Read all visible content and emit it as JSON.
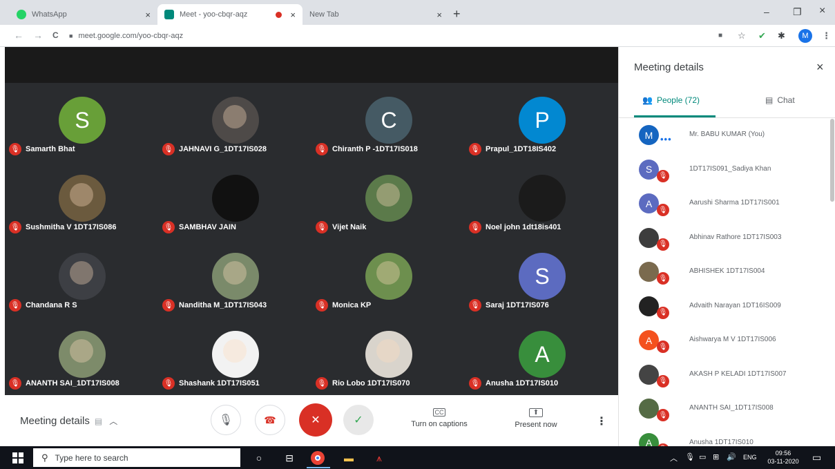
{
  "browser": {
    "tabs": [
      {
        "title": "WhatsApp",
        "favicon_color": "#25d366",
        "active": false
      },
      {
        "title": "Meet - yoo-cbqr-aqz",
        "favicon_color": "#00897b",
        "active": true,
        "recording": true
      },
      {
        "title": "New Tab",
        "favicon_color": "",
        "active": false
      }
    ],
    "tab_close": "×",
    "new_tab": "+",
    "window_controls": {
      "minimize": "–",
      "maximize": "❐",
      "close": "×"
    },
    "nav": {
      "back": "←",
      "forward": "→",
      "reload": "C"
    },
    "url": "meet.google.com/yoo-cbqr-aqz",
    "profile_initial": "M"
  },
  "meet": {
    "tiles": [
      {
        "name": "Samarth Bhat",
        "initial": "S",
        "color": "#689f38"
      },
      {
        "name": "JAHNAVI G_1DT17IS028",
        "initial": "",
        "color": "#4e4a48"
      },
      {
        "name": "Chiranth P -1DT17IS018",
        "initial": "C",
        "color": "#455a64"
      },
      {
        "name": "Prapul_1DT18IS402",
        "initial": "P",
        "color": "#0288d1"
      },
      {
        "name": "Sushmitha V 1DT17IS086",
        "initial": "",
        "color": "#6b5a3e"
      },
      {
        "name": "SAMBHAV JAIN",
        "initial": "",
        "color": "#111111"
      },
      {
        "name": "Vijet Naik",
        "initial": "",
        "color": "#5b7a4a"
      },
      {
        "name": "Noel john 1dt18is401",
        "initial": "",
        "color": "#1b1b1b"
      },
      {
        "name": "Chandana R S",
        "initial": "",
        "color": "#3d3f44"
      },
      {
        "name": "Nanditha M_1DT17IS043",
        "initial": "",
        "color": "#7a8a6a"
      },
      {
        "name": "Monica KP",
        "initial": "",
        "color": "#6d8f4e"
      },
      {
        "name": "Saraj 1DT17IS076",
        "initial": "S",
        "color": "#5c6bc0"
      },
      {
        "name": "ANANTH SAI_1DT17IS008",
        "initial": "",
        "color": "#7d8b6a"
      },
      {
        "name": "Shashank 1DT17IS051",
        "initial": "",
        "color": "#f2f2f2"
      },
      {
        "name": "Rio Lobo 1DT17IS070",
        "initial": "",
        "color": "#d9d4cc"
      },
      {
        "name": "Anusha 1DT17IS010",
        "initial": "A",
        "color": "#388e3c"
      }
    ],
    "mic_off_glyph": "🎙",
    "controls": {
      "meeting_details": "Meeting details",
      "captions_label": "Turn on captions",
      "captions_icon": "CC",
      "present_label": "Present now",
      "present_icon": "⬆",
      "more": "⋮",
      "mic_icon": "🎙",
      "hangup_icon": "☎",
      "camera_icon": "✕",
      "check_icon": "✓"
    }
  },
  "panel": {
    "title": "Meeting details",
    "close": "×",
    "tabs": {
      "people": "People (72)",
      "chat": "Chat"
    },
    "participants": [
      {
        "name": "Mr. BABU KUMAR (You)",
        "initial": "M",
        "color": "#1565c0",
        "self": true
      },
      {
        "name": "1DT17IS091_Sadiya Khan",
        "initial": "S",
        "color": "#5c6bc0"
      },
      {
        "name": "Aarushi Sharma 1DT17IS001",
        "initial": "A",
        "color": "#5c6bc0"
      },
      {
        "name": "Abhinav Rathore 1DT17IS003",
        "initial": "",
        "color": "#3d3d3d"
      },
      {
        "name": "ABHISHEK 1DT17IS004",
        "initial": "",
        "color": "#7a6a4e"
      },
      {
        "name": "Advaith Narayan 1DT16IS009",
        "initial": "",
        "color": "#222222"
      },
      {
        "name": "Aishwarya M V 1DT17IS006",
        "initial": "A",
        "color": "#f4511e"
      },
      {
        "name": "AKASH P KELADI 1DT17IS007",
        "initial": "",
        "color": "#444444"
      },
      {
        "name": "ANANTH SAI_1DT17IS008",
        "initial": "",
        "color": "#556b45"
      },
      {
        "name": "Anusha 1DT17IS010",
        "initial": "A",
        "color": "#388e3c"
      }
    ]
  },
  "taskbar": {
    "search_placeholder": "Type here to search",
    "lang": "ENG",
    "time": "09:56",
    "date": "03-11-2020"
  },
  "colors": {
    "accent": "#00897b",
    "danger": "#d93025",
    "dark_bg": "#2a2c2f"
  }
}
